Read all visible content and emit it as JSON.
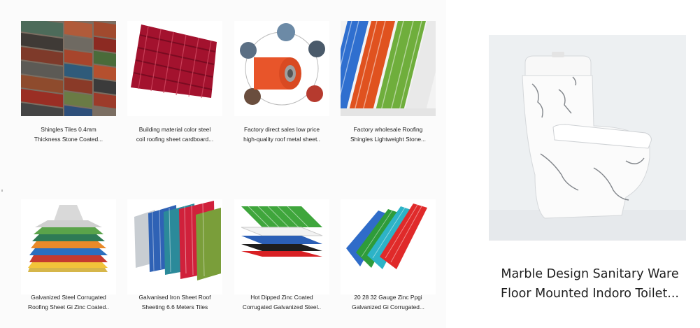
{
  "products": [
    {
      "line1": "Shingles Tiles 0.4mm",
      "line2": "Thickness Stone Coated..."
    },
    {
      "line1": "Building material color steel",
      "line2": "coil roofing sheet cardboard..."
    },
    {
      "line1": "Factory direct sales low price",
      "line2": "high-quality roof metal sheet.."
    },
    {
      "line1": "Factory wholesale Roofing",
      "line2": "Shingles Lightweight Stone..."
    },
    {
      "line1": "Galvanized Steel Corrugated",
      "line2": "Roofing Sheet Gi Zinc Coated.."
    },
    {
      "line1": "Galvanised Iron Sheet Roof",
      "line2": "Sheeting 6.6 Meters Tiles"
    },
    {
      "line1": "Hot Dipped Zinc Coated",
      "line2": "Corrugated Galvanized Steel.."
    },
    {
      "line1": "20 28 32 Gauge Zinc Ppgi",
      "line2": "Galvanized Gi Corrugated..."
    }
  ],
  "featured": {
    "line1": "Marble Design Sanitary Ware",
    "line2": "Floor Mounted Indoro Toilet..."
  }
}
